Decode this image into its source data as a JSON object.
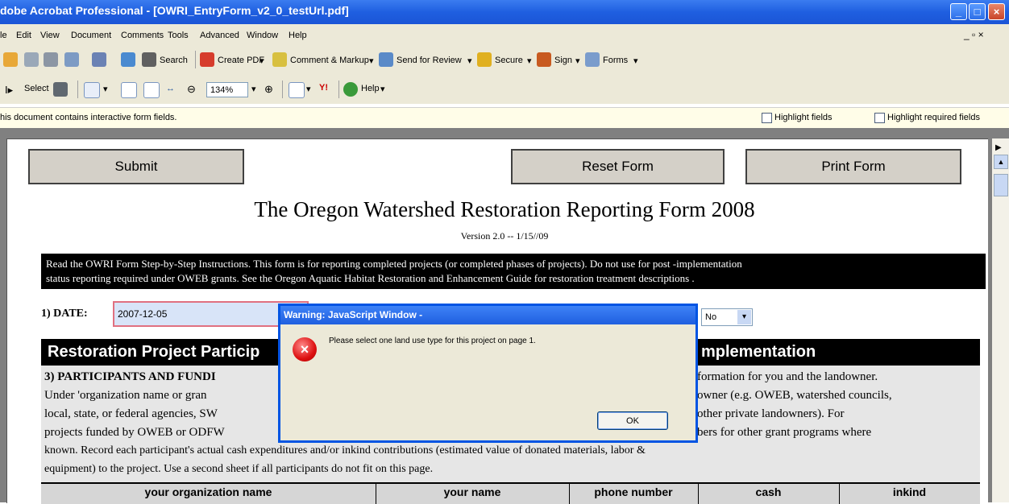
{
  "window": {
    "title": "dobe Acrobat Professional - [OWRI_EntryForm_v2_0_testUrl.pdf]"
  },
  "menu": [
    "le",
    "Edit",
    "View",
    "Document",
    "Comments",
    "Tools",
    "Advanced",
    "Window",
    "Help"
  ],
  "toolbar1": {
    "search": "Search",
    "create_pdf": "Create PDF",
    "comment_markup": "Comment & Markup",
    "send_review": "Send for Review",
    "secure": "Secure",
    "sign": "Sign",
    "forms": "Forms"
  },
  "toolbar2": {
    "select": "Select",
    "zoom": "134%",
    "help": "Help",
    "yahoo": "Y!"
  },
  "docbar": {
    "message": "his document contains interactive form fields.",
    "highlight_fields": "Highlight fields",
    "highlight_required": "Highlight required fields"
  },
  "form": {
    "submit": "Submit",
    "reset": "Reset Form",
    "print": "Print Form",
    "title": "The Oregon Watershed Restoration Reporting Form 2008",
    "version": "Version 2.0 -- 1/15//09",
    "instructions_1": "Read the OWRI Form Step-by-Step Instructions.  This form is for reporting completed projects (or completed phases of projects).  Do not use for post -implementation",
    "instructions_2": "status reporting required under OWEB grants.  See the Oregon Aquatic Habitat Restoration and Enhancement Guide for restoration treatment descriptions .",
    "date_label": "1) DATE:",
    "date_value": "2007-12-05",
    "no_select": "No",
    "section_left": "Restoration Project Particip",
    "section_right": "mplementation",
    "p3_title": "3) PARTICIPANTS AND FUNDI",
    "p_line2_left": "Under 'organization name or gran",
    "p_line3_left": "local, state, or federal agencies, SW",
    "p_line4_left": "projects funded by OWEB or ODFW",
    "p_line1_right": "formation for you and the landowner.",
    "p_line2_right": "owner (e.g. OWEB, watershed councils,",
    "p_line3_right": "other private landowners).  For",
    "p_line4_right": "bers for other grant programs where",
    "p_line5": "known. Record each participant's actual cash expenditures and/or inkind contributions (estimated value of donated materials, labor &",
    "p_line6": "equipment) to the project. Use a second sheet if all participants do not fit on this page.",
    "columns": [
      "your organization name",
      "your name",
      "phone number",
      "cash",
      "inkind"
    ]
  },
  "dialog": {
    "title": "Warning: JavaScript Window -",
    "message": "Please select one land use type for this project on page 1.",
    "ok": "OK"
  }
}
